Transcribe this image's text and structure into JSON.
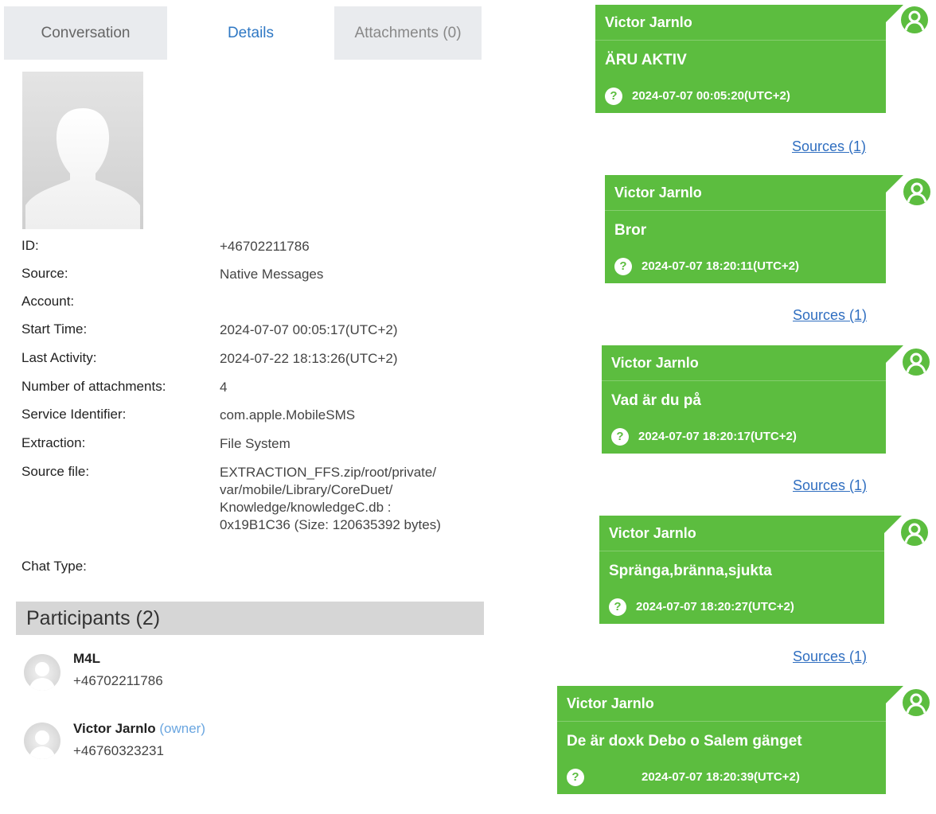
{
  "tabs": {
    "conversation": "Conversation",
    "details": "Details",
    "attachments": "Attachments (0)"
  },
  "details": {
    "id_label": "ID:",
    "id_value": "+46702211786",
    "source_label": "Source:",
    "source_value": "Native Messages",
    "account_label": "Account:",
    "start_label": "Start Time:",
    "start_value": "2024-07-07 00:05:17(UTC+2)",
    "last_label": "Last Activity:",
    "last_value": "2024-07-22 18:13:26(UTC+2)",
    "attach_label": "Number of attachments:",
    "attach_value": "4",
    "service_label": "Service Identifier:",
    "service_value": "com.apple.MobileSMS",
    "extraction_label": "Extraction:",
    "extraction_value": "File System",
    "sourcefile_label": "Source file:",
    "sourcefile_line1": "EXTRACTION_FFS.zip/root/private/",
    "sourcefile_line2": "var/mobile/Library/CoreDuet/",
    "sourcefile_line3": "Knowledge/knowledgeC.db :",
    "sourcefile_line4": "0x19B1C36 (Size: 120635392 bytes)",
    "chattype_label": "Chat Type:"
  },
  "participants": {
    "header": "Participants (2)",
    "items": [
      {
        "name": "M4L",
        "phone": "+46702211786",
        "tag": ""
      },
      {
        "name": "Victor Jarnlo",
        "phone": "+46760323231",
        "tag": "(owner)"
      }
    ]
  },
  "messages": [
    {
      "sender": "Victor Jarnlo",
      "text": "ÄRU AKTIV",
      "time": "2024-07-07 00:05:20(UTC+2)",
      "sources": "Sources (1)"
    },
    {
      "sender": "Victor Jarnlo",
      "text": "Bror",
      "time": "2024-07-07 18:20:11(UTC+2)",
      "sources": "Sources (1)"
    },
    {
      "sender": "Victor Jarnlo",
      "text": "Vad är du på",
      "time": "2024-07-07 18:20:17(UTC+2)",
      "sources": "Sources (1)"
    },
    {
      "sender": "Victor Jarnlo",
      "text": "Spränga,bränna,sjukta",
      "time": "2024-07-07 18:20:27(UTC+2)",
      "sources": "Sources (1)"
    },
    {
      "sender": "Victor Jarnlo",
      "text": "De är doxk Debo o Salem gänget",
      "time": "2024-07-07 18:20:39(UTC+2)"
    }
  ],
  "icons": {
    "help_glyph": "?",
    "bubble_color": "#5cbd3f",
    "link_color": "#2f6ec0",
    "active_tab_color": "#2f78c4"
  }
}
